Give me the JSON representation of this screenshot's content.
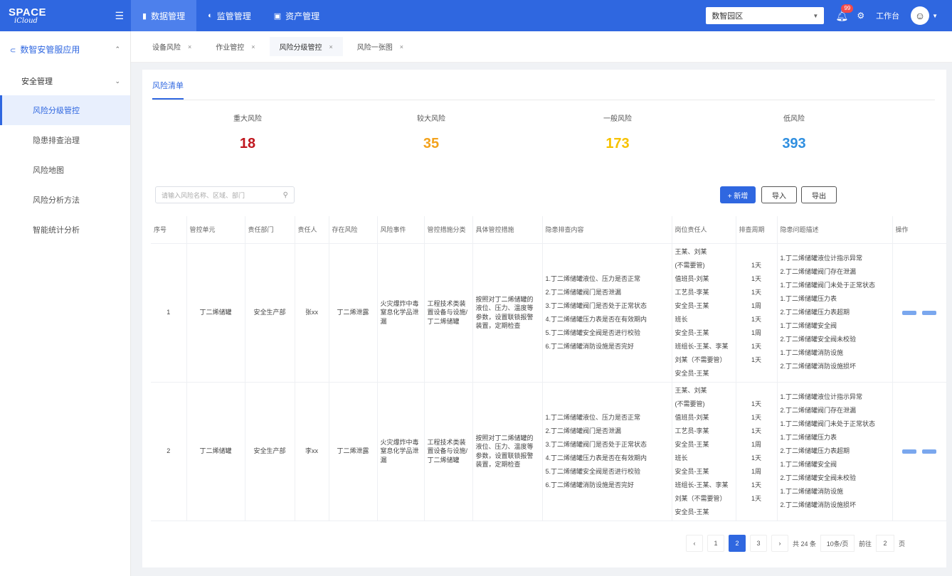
{
  "header": {
    "logo_main": "SPACE",
    "logo_sub": "iCloud",
    "nav": [
      {
        "label": "数据管理",
        "icon": "▮"
      },
      {
        "label": "监管管理",
        "icon": "◐"
      },
      {
        "label": "资产管理",
        "icon": "▣"
      }
    ],
    "system_select": "数智园区",
    "badge_count": "99",
    "workbench": "工作台"
  },
  "sidebar": {
    "group": "数智安管服应用",
    "sub": "安全管理",
    "items": [
      "风险分级管控",
      "隐患排查治理",
      "风险地图",
      "风险分析方法",
      "智能统计分析"
    ]
  },
  "tabs": [
    {
      "label": "设备风险",
      "close": "×"
    },
    {
      "label": "作业管控",
      "close": "×"
    },
    {
      "label": "风险分级管控",
      "close": "×"
    },
    {
      "label": "风险一张图",
      "close": "×"
    }
  ],
  "subtab": "风险清单",
  "stats": [
    {
      "label": "重大风险",
      "value": "18",
      "color": "#c0161e"
    },
    {
      "label": "较大风险",
      "value": "35",
      "color": "#f3a21b"
    },
    {
      "label": "一般风险",
      "value": "173",
      "color": "#f7c200"
    },
    {
      "label": "低风险",
      "value": "393",
      "color": "#2f8fe0"
    }
  ],
  "search_placeholder": "请输入风险名称、区域、部门",
  "buttons": {
    "add": "+ 新增",
    "import": "导入",
    "export": "导出"
  },
  "table": {
    "headers": [
      "序号",
      "管控单元",
      "责任部门",
      "责任人",
      "存在风险",
      "风险事件",
      "管控措施分类",
      "具体管控措施",
      "隐患排查内容",
      "岗位责任人",
      "排查周期",
      "隐患问题描述",
      "操作"
    ],
    "rows": [
      {
        "index": "1",
        "unit": "丁二烯储罐",
        "dept": "安全生产部",
        "owner": "张xx",
        "risk": "丁二烯泄露",
        "event": "火灾爆炸中毒窒息化学品泄漏",
        "category": "工程技术类装置设备与设施/丁二烯储罐",
        "measures": "按照对丁二烯储罐的液位、压力、温度等参数，设置联锁报警装置，定期检查",
        "checks": [
          "1.丁二烯储罐液位、压力是否正常",
          "2.丁二烯储罐阀门是否泄漏",
          "3.丁二烯储罐阀门是否处于正常状态",
          "4.丁二烯储罐压力表是否在有效期内",
          "5.丁二烯储罐安全阀是否进行校验",
          "6.丁二烯储罐消防设施是否完好"
        ],
        "persons": [
          "王某、刘某",
          "(不需要管)",
          "值班员-刘某",
          "工艺员-李某",
          "安全员-王某",
          "班长",
          "安全员-王某",
          "班组长-王某、李某",
          "刘某（不需要管）",
          "安全员-王某"
        ],
        "cycles": [
          "1天",
          "1天",
          "1天",
          "1周",
          "1天",
          "1周",
          "1天",
          "1天"
        ],
        "desc": [
          "1.丁二烯储罐液位计指示异常",
          "2.丁二烯储罐阀门存在泄漏",
          "1.丁二烯储罐阀门未处于正常状态",
          "1.丁二烯储罐压力表",
          "2.丁二烯储罐压力表超期",
          "1.丁二烯储罐安全阀",
          "2.丁二烯储罐安全阀未校验",
          "1.丁二烯储罐消防设施",
          "2.丁二烯储罐消防设施损坏"
        ]
      },
      {
        "index": "2",
        "unit": "丁二烯储罐",
        "dept": "安全生产部",
        "owner": "李xx",
        "risk": "丁二烯泄露",
        "event": "火灾爆炸中毒窒息化学品泄漏",
        "category": "工程技术类装置设备与设施/丁二烯储罐",
        "measures": "按照对丁二烯储罐的液位、压力、温度等参数，设置联锁报警装置，定期检查",
        "checks": [
          "1.丁二烯储罐液位、压力是否正常",
          "2.丁二烯储罐阀门是否泄漏",
          "3.丁二烯储罐阀门是否处于正常状态",
          "4.丁二烯储罐压力表是否在有效期内",
          "5.丁二烯储罐安全阀是否进行校验",
          "6.丁二烯储罐消防设施是否完好"
        ],
        "persons": [
          "王某、刘某",
          "(不需要管)",
          "值班员-刘某",
          "工艺员-李某",
          "安全员-王某",
          "班长",
          "安全员-王某",
          "班组长-王某、李某",
          "刘某（不需要管）",
          "安全员-王某"
        ],
        "cycles": [
          "1天",
          "1天",
          "1天",
          "1周",
          "1天",
          "1周",
          "1天",
          "1天"
        ],
        "desc": [
          "1.丁二烯储罐液位计指示异常",
          "2.丁二烯储罐阀门存在泄漏",
          "1.丁二烯储罐阀门未处于正常状态",
          "1.丁二烯储罐压力表",
          "2.丁二烯储罐压力表超期",
          "1.丁二烯储罐安全阀",
          "2.丁二烯储罐安全阀未校验",
          "1.丁二烯储罐消防设施",
          "2.丁二烯储罐消防设施损坏"
        ]
      }
    ]
  },
  "pagination": {
    "prev": "‹",
    "pages": [
      "1",
      "2",
      "3"
    ],
    "next": "›",
    "total": "共 24 条",
    "size": "10条/页",
    "goto": "前往",
    "page_input": "2",
    "page_unit": "页"
  }
}
